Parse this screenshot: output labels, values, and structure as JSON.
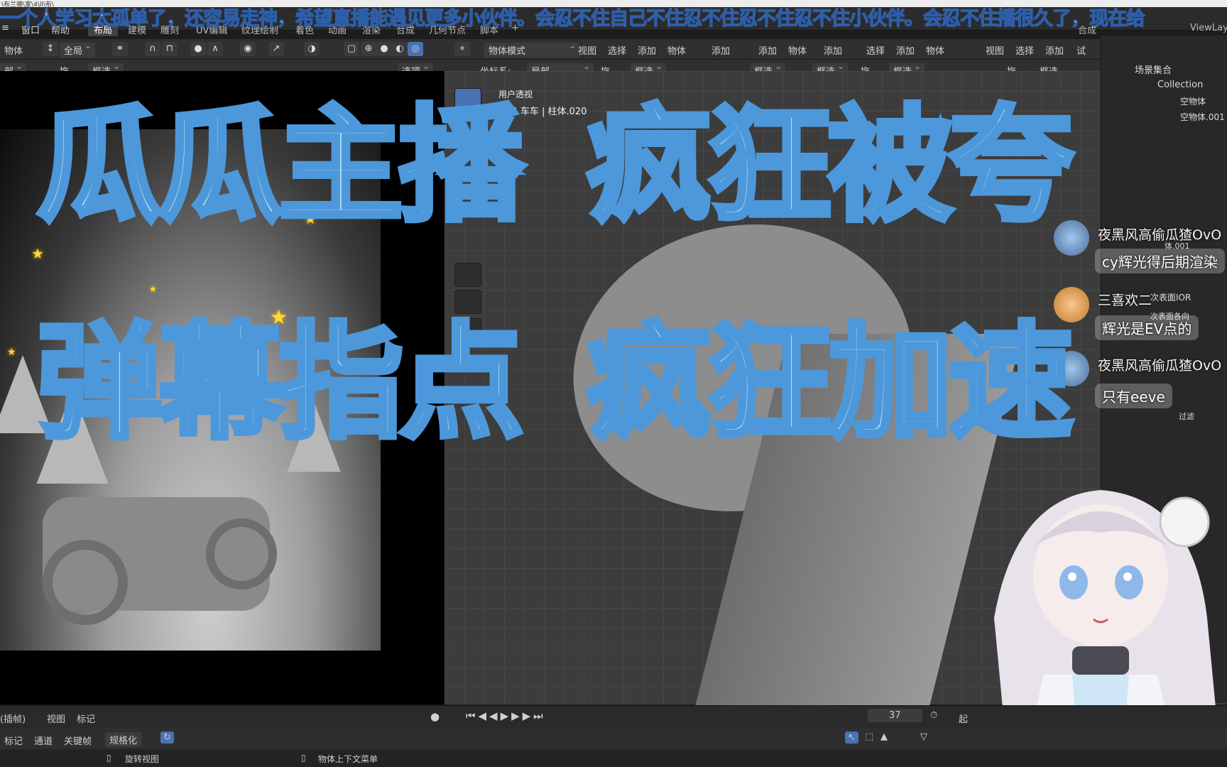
{
  "titlebar": {
    "text": "\\布兰德\\家\\4\\ll\\布\\"
  },
  "danmaku": {
    "text": "一个人学习太孤单了，还容易走神，希望直播能遇见更多小伙伴。会忍不住自己不住忍不住忍不住忍不住小伙伴。会忍不住播很久了，现在给"
  },
  "menu": {
    "items": [
      "窗口",
      "帮助"
    ],
    "tabs": [
      "布局",
      "建模",
      "雕刻",
      "UV编辑",
      "纹理绘制",
      "着色",
      "动画",
      "渲染",
      "合成",
      "几何节点",
      "脚本"
    ],
    "add_tab": "+",
    "right_tab": "合成",
    "view_layer": "ViewLay"
  },
  "left_header": {
    "object": "物体",
    "transform": "全局",
    "row2_local": "部",
    "row2_drag": "拖...",
    "row2_select": "框选",
    "options": "选项"
  },
  "right_header": {
    "mode": "物体模式",
    "menu": [
      "视图",
      "选择",
      "添加",
      "物体"
    ],
    "extra": [
      "添加",
      "添加",
      "物体",
      "添加",
      "选择",
      "添加",
      "物体",
      "视图",
      "选择",
      "添加",
      "试"
    ],
    "coord_label": "坐标系:",
    "coord_value": "局部",
    "drag": "拖...",
    "select1": "框选",
    "select2": "框选",
    "select3": "框选",
    "drag2": "拖...",
    "select4": "框选",
    "drag3": "拖...",
    "select5": "框选"
  },
  "viewport_info": {
    "view": "用户透视",
    "object": "(37) 车车 | 柱体.020"
  },
  "outliner": {
    "title": "场景集合",
    "collection": "Collection",
    "items": [
      "空物体",
      "空物体.001",
      "体.001",
      "次表面IOR",
      "次表面各向",
      "过滤"
    ]
  },
  "chat": [
    {
      "name": "夜黑风高偷瓜猹OvO",
      "message": "cy辉光得后期渲染"
    },
    {
      "name": "三喜欢二",
      "message": "辉光是EV点的"
    },
    {
      "name": "夜黑风高偷瓜猹OvO",
      "message": "只有eeve"
    }
  ],
  "captions": {
    "line1a": "瓜瓜主播",
    "line1b": "疯狂被夸",
    "line2a": "弹幕指点",
    "line2b": "疯狂加速"
  },
  "timeline": {
    "mode": "(插帧)",
    "view": "视图",
    "marker": "标记",
    "frame": "37",
    "start": "起"
  },
  "graph": {
    "marker": "标记",
    "channel": "通道",
    "keyframe": "关键帧",
    "normalize": "规格化"
  },
  "status": {
    "rotate": "旋转视图",
    "context": "物体上下文菜单"
  },
  "colors": {
    "caption_fill": "#b9e4f7",
    "caption_stroke": "#4d98da",
    "danmaku_stroke": "#2e5ea8",
    "blender_bg": "#303030",
    "accent": "#4772b3"
  }
}
